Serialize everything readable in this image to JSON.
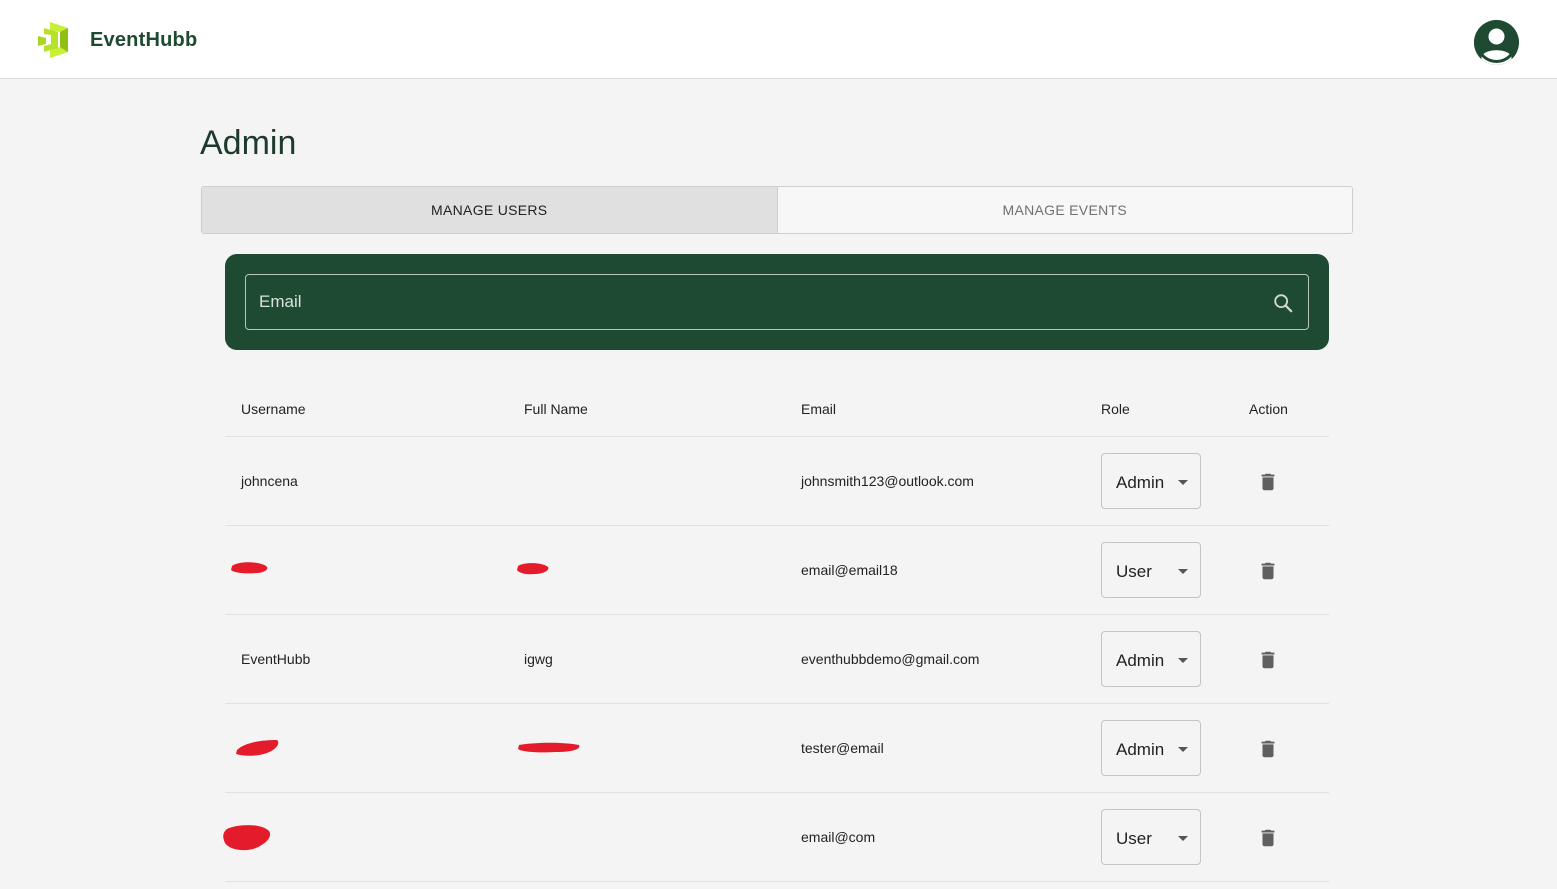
{
  "app": {
    "brand": "EventHubb",
    "brand_color": "#1e4a32",
    "logo_accent": "#c6f135",
    "logo_icon": "stacked-chevron-logo",
    "avatar_icon": "user-avatar-icon"
  },
  "page": {
    "title": "Admin"
  },
  "tabs": [
    {
      "label": "MANAGE USERS",
      "active": true
    },
    {
      "label": "MANAGE EVENTS",
      "active": false
    }
  ],
  "search": {
    "placeholder": "Email",
    "value": "",
    "icon": "search-icon"
  },
  "table": {
    "headers": {
      "username": "Username",
      "full_name": "Full Name",
      "email": "Email",
      "role": "Role",
      "action": "Action"
    },
    "rows": [
      {
        "username": "johncena",
        "full_name": "",
        "email": "johnsmith123@outlook.com",
        "role": "Admin",
        "username_redacted": false,
        "full_name_redacted": false
      },
      {
        "username": "",
        "full_name": "",
        "email": "email@email18",
        "role": "User",
        "username_redacted": true,
        "full_name_redacted": true
      },
      {
        "username": "EventHubb",
        "full_name": "igwg",
        "email": "eventhubbdemo@gmail.com",
        "role": "Admin",
        "username_redacted": false,
        "full_name_redacted": false
      },
      {
        "username": "",
        "full_name": "",
        "email": "tester@email",
        "role": "Admin",
        "username_redacted": true,
        "full_name_redacted": true
      },
      {
        "username": "",
        "full_name": "",
        "email": "email@com",
        "role": "User",
        "username_redacted": true,
        "full_name_redacted": false
      }
    ],
    "action_icon": "trash-icon"
  },
  "colors": {
    "redaction": "#e31b2b",
    "panel": "#1e4a32"
  }
}
